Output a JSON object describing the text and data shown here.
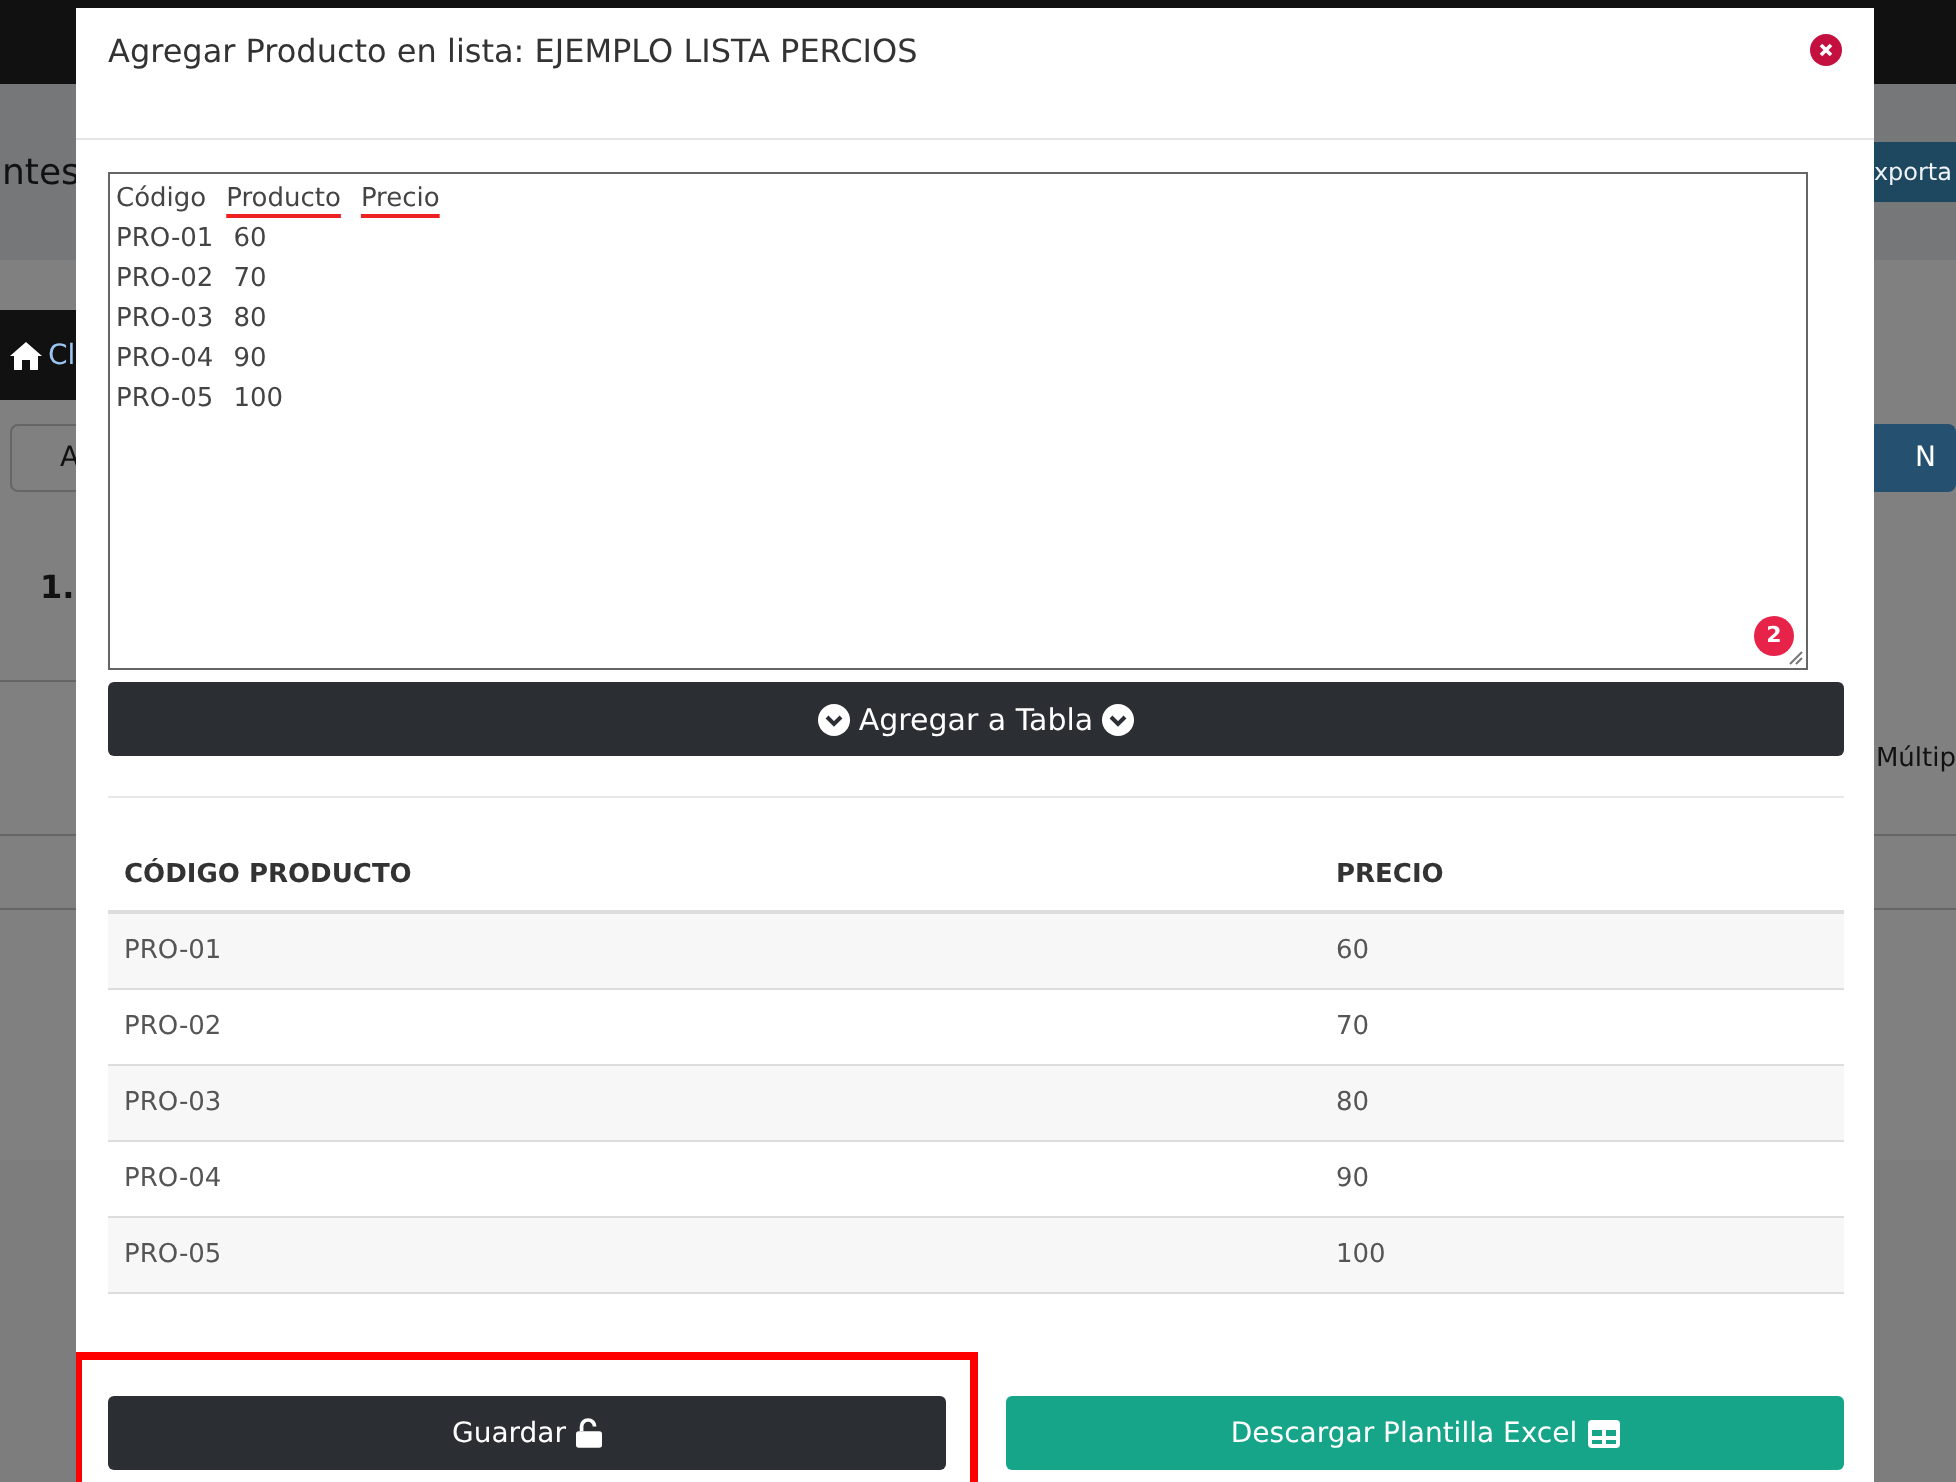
{
  "background": {
    "heading_fragment": "ntes",
    "export_fragment": "xporta",
    "breadcrumb_fragment": "Cl",
    "left_button_fragment": "A",
    "right_button_fragment": "N",
    "row_number_fragment": "1.",
    "cell_fragment": "Múltip"
  },
  "modal": {
    "title": "Agregar Producto en lista: EJEMPLO LISTA PERCIOS",
    "input": {
      "lines": [
        [
          {
            "text": "Código",
            "flagged": false
          },
          {
            "text": "Producto",
            "flagged": true
          },
          {
            "text": "Precio",
            "flagged": true
          }
        ],
        [
          {
            "text": "PRO-01",
            "flagged": false
          },
          {
            "text": "60",
            "flagged": false
          }
        ],
        [
          {
            "text": "PRO-02",
            "flagged": false
          },
          {
            "text": "70",
            "flagged": false
          }
        ],
        [
          {
            "text": "PRO-03",
            "flagged": false
          },
          {
            "text": "80",
            "flagged": false
          }
        ],
        [
          {
            "text": "PRO-04",
            "flagged": false
          },
          {
            "text": "90",
            "flagged": false
          }
        ],
        [
          {
            "text": "PRO-05",
            "flagged": false
          },
          {
            "text": "100",
            "flagged": false
          }
        ]
      ],
      "badge": "2"
    },
    "add_button": "Agregar a Tabla",
    "table": {
      "columns": [
        "CÓDIGO PRODUCTO",
        "PRECIO"
      ],
      "rows": [
        [
          "PRO-01",
          "60"
        ],
        [
          "PRO-02",
          "70"
        ],
        [
          "PRO-03",
          "80"
        ],
        [
          "PRO-04",
          "90"
        ],
        [
          "PRO-05",
          "100"
        ]
      ]
    },
    "buttons": [
      {
        "label": "Guardar",
        "kind": "save",
        "highlighted": true
      },
      {
        "label": "Descargar Plantilla Excel",
        "kind": "download",
        "highlighted": false
      }
    ]
  }
}
